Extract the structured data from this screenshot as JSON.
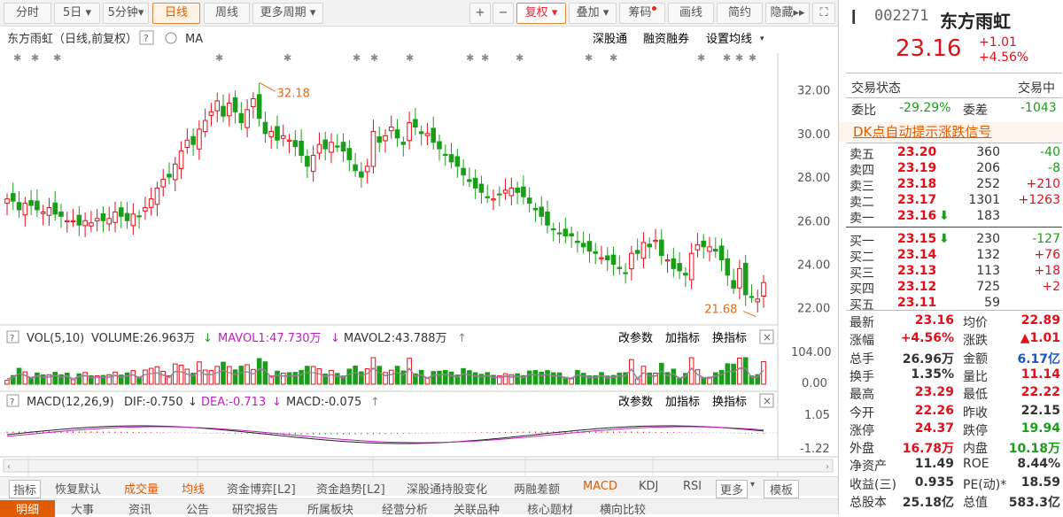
{
  "toolbar": {
    "tabs": [
      "分时",
      "5日",
      "5分钟",
      "日线",
      "周线",
      "更多周期"
    ],
    "active_tab": "日线",
    "right_buttons": [
      "复权",
      "叠加",
      "筹码",
      "画线",
      "简约",
      "隐藏"
    ],
    "plus_label": "+",
    "minus_label": "−"
  },
  "chart_header": {
    "title": "东方雨虹（日线,前复权）",
    "ma_label": "MA",
    "links": [
      "深股通",
      "融资融券",
      "设置均线"
    ]
  },
  "price_labels": {
    "high": "32.18",
    "low": "21.68"
  },
  "y_axis_price": [
    "32.00",
    "30.00",
    "28.00",
    "26.00",
    "24.00",
    "22.00"
  ],
  "vol_panel": {
    "label": "VOL(5,10)",
    "volume": "VOLUME:26.963万",
    "mavol1": "MAVOL1:47.730万",
    "mavol2": "MAVOL2:43.788万",
    "buttons": [
      "改参数",
      "加指标",
      "换指标"
    ],
    "y_axis": [
      "104.00",
      "0.00"
    ]
  },
  "macd_panel": {
    "label": "MACD(12,26,9)",
    "dif": "DIF:-0.750",
    "dea": "DEA:-0.713",
    "macd": "MACD:-0.075",
    "buttons": [
      "改参数",
      "加指标",
      "换指标"
    ],
    "y_axis": [
      "1.05",
      "-1.22"
    ]
  },
  "x_axis": [
    "07",
    "08",
    "09",
    "10",
    "11"
  ],
  "bottom_bar": [
    "指标",
    "恢复默认",
    "成交量",
    "均线",
    "资金博弈[L2]",
    "资金趋势[L2]",
    "深股通持股变化",
    "两融差额",
    "MACD",
    "KDJ",
    "RSI",
    "更多",
    "模板"
  ],
  "bottom_tabs": [
    "明细",
    "大事",
    "资讯",
    "公告",
    "研究报告",
    "所属板块",
    "经营分析",
    "关联品种",
    "核心题材",
    "横向比较"
  ],
  "stock": {
    "code": "002271",
    "name": "东方雨虹",
    "price": "23.16",
    "change": "+1.01",
    "change_pct": "+4.56%"
  },
  "status": {
    "label": "交易状态",
    "value": "交易中"
  },
  "weibi": {
    "label1": "委比",
    "value1": "-29.29%",
    "label2": "委差",
    "value2": "-1043"
  },
  "dk_signal": "DK点自动提示涨跌信号",
  "sell_orders": [
    {
      "label": "卖五",
      "price": "23.20",
      "vol": "360",
      "chg": "-40"
    },
    {
      "label": "卖四",
      "price": "23.19",
      "vol": "206",
      "chg": "-8"
    },
    {
      "label": "卖三",
      "price": "23.18",
      "vol": "252",
      "chg": "+210"
    },
    {
      "label": "卖二",
      "price": "23.17",
      "vol": "1301",
      "chg": "+1263"
    },
    {
      "label": "卖一",
      "price": "23.16",
      "vol": "183",
      "chg": ""
    }
  ],
  "buy_orders": [
    {
      "label": "买一",
      "price": "23.15",
      "vol": "230",
      "chg": "-127"
    },
    {
      "label": "买二",
      "price": "23.14",
      "vol": "132",
      "chg": "+76"
    },
    {
      "label": "买三",
      "price": "23.13",
      "vol": "113",
      "chg": "+18"
    },
    {
      "label": "买四",
      "price": "23.12",
      "vol": "725",
      "chg": "+2"
    },
    {
      "label": "买五",
      "price": "23.11",
      "vol": "59",
      "chg": ""
    }
  ],
  "stats": [
    {
      "l1": "最新",
      "v1": "23.16",
      "l2": "均价",
      "v2": "22.89"
    },
    {
      "l1": "涨幅",
      "v1": "+4.56%",
      "l2": "涨跌",
      "v2": "▲1.01"
    },
    {
      "l1": "总手",
      "v1": "26.96万",
      "l2": "金额",
      "v2": "6.17亿"
    },
    {
      "l1": "换手",
      "v1": "1.35%",
      "l2": "量比",
      "v2": "11.14"
    },
    {
      "l1": "最高",
      "v1": "23.29",
      "l2": "最低",
      "v2": "22.22"
    },
    {
      "l1": "今开",
      "v1": "22.26",
      "l2": "昨收",
      "v2": "22.15"
    },
    {
      "l1": "涨停",
      "v1": "24.37",
      "l2": "跌停",
      "v2": "19.94"
    },
    {
      "l1": "外盘",
      "v1": "16.78万",
      "l2": "内盘",
      "v2": "10.18万"
    },
    {
      "l1": "净资产",
      "v1": "11.49",
      "l2": "ROE",
      "v2": "8.44%"
    },
    {
      "l1": "收益(三)",
      "v1": "0.935",
      "l2": "PE(动)*",
      "v2": "18.59"
    },
    {
      "l1": "总股本",
      "v1": "25.18亿",
      "l2": "总值",
      "v2": "583.3亿"
    }
  ],
  "colors": {
    "up": "#e0101a",
    "down": "#1a9e1a",
    "accent": "#e05a00"
  },
  "chart_data": {
    "type": "candlestick",
    "x_ticks": [
      "07",
      "08",
      "09",
      "10",
      "11"
    ],
    "ylim": [
      21.5,
      32.8
    ],
    "annotated_high": 32.18,
    "annotated_low": 21.68,
    "closes": [
      27.0,
      26.9,
      26.5,
      26.8,
      26.7,
      26.5,
      26.4,
      26.6,
      26.3,
      26.2,
      26.0,
      26.0,
      25.8,
      26.0,
      25.9,
      26.1,
      26.0,
      26.1,
      26.4,
      26.2,
      26.0,
      26.3,
      26.2,
      26.6,
      27.0,
      27.5,
      27.9,
      28.0,
      28.6,
      29.2,
      29.7,
      29.5,
      30.2,
      30.6,
      31.0,
      31.5,
      30.8,
      31.4,
      31.0,
      30.5,
      31.1,
      31.6,
      30.7,
      30.0,
      30.1,
      29.7,
      29.9,
      29.7,
      29.4,
      29.0,
      28.5,
      29.0,
      29.5,
      29.3,
      29.6,
      29.4,
      29.2,
      28.8,
      28.3,
      28.0,
      28.5,
      30.1,
      29.6,
      29.9,
      30.3,
      29.8,
      29.5,
      30.5,
      30.3,
      30.0,
      30.0,
      29.6,
      29.3,
      29.0,
      28.7,
      28.5,
      28.1,
      27.8,
      27.5,
      27.3,
      27.1,
      27.0,
      27.2,
      27.4,
      27.5,
      27.3,
      27.1,
      26.8,
      26.5,
      26.2,
      25.8,
      25.6,
      25.4,
      25.3,
      25.3,
      25.0,
      24.8,
      24.6,
      24.5,
      24.3,
      24.2,
      24.0,
      23.8,
      23.6,
      24.5,
      24.5,
      25.0,
      24.8,
      25.1,
      24.4,
      24.2,
      23.8,
      23.7,
      23.5,
      24.5,
      24.9,
      24.8,
      24.8,
      24.6,
      24.2,
      23.5,
      22.9,
      23.8,
      22.6,
      22.5,
      22.4,
      23.16
    ]
  }
}
